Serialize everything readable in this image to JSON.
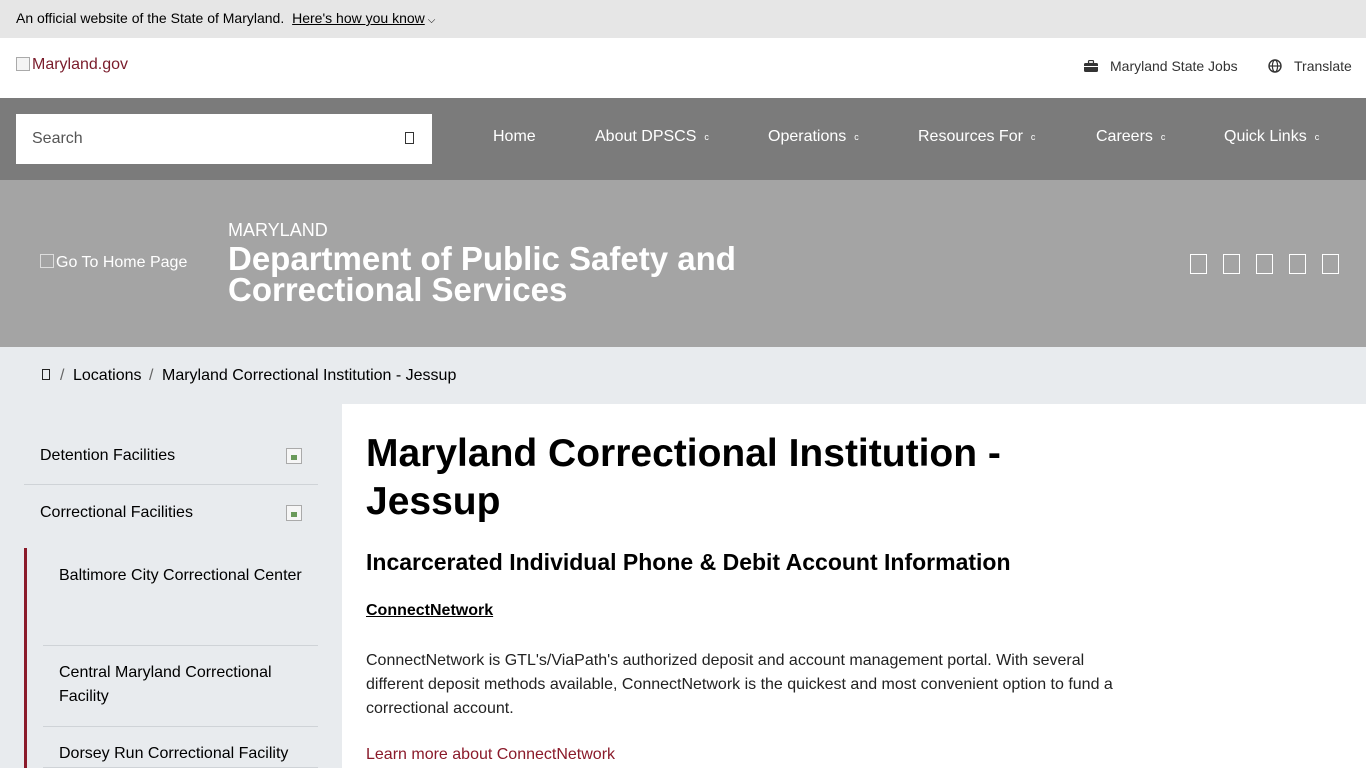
{
  "official_bar": {
    "text": "An official website of the State of Maryland.",
    "link": "Here's how you know"
  },
  "header": {
    "logo_alt": "Maryland.gov",
    "jobs_label": "Maryland State Jobs",
    "translate_label": "Translate"
  },
  "search": {
    "placeholder": "Search"
  },
  "nav": {
    "items": [
      {
        "label": "Home",
        "has_menu": false
      },
      {
        "label": "About DPSCS",
        "has_menu": true
      },
      {
        "label": "Operations",
        "has_menu": true
      },
      {
        "label": "Resources For",
        "has_menu": true
      },
      {
        "label": "Careers",
        "has_menu": true
      },
      {
        "label": "Quick Links",
        "has_menu": true
      }
    ],
    "caret": "c"
  },
  "banner": {
    "home_alt": "Go To Home Page",
    "state": "MARYLAND",
    "department": "Department of Public Safety and Correctional Services",
    "social_icons": [
      "social-icon-1",
      "social-icon-2",
      "social-icon-3",
      "social-icon-4",
      "social-icon-5"
    ]
  },
  "breadcrumb": {
    "items": [
      "Locations",
      "Maryland Correctional Institution - Jessup"
    ],
    "separator": "/"
  },
  "sidebar": {
    "items": [
      {
        "label": "Detention Facilities"
      },
      {
        "label": "Correctional Facilities"
      }
    ],
    "sub_items": [
      {
        "label": "Baltimore City Correctional Center"
      },
      {
        "label": "Central Maryland Correctional Facility"
      },
      {
        "label": "Dorsey Run Correctional Facility"
      }
    ]
  },
  "main": {
    "title": "Maryland Correctional Institution - Jessup",
    "subtitle": "Incarcerated Individual Phone & Debit Account Information",
    "link_heading": "ConnectNetwork",
    "paragraph": "ConnectNetwork is GTL's/ViaPath's authorized deposit and account management portal. With several different deposit methods available, ConnectNetwork is the quickest and most convenient option to fund a correctional account.",
    "learn_more": "Learn more about ConnectNetwork"
  },
  "colors": {
    "accent": "#8a1a2a",
    "nav_bg": "#7b7b7b",
    "banner_bg": "#a4a4a4",
    "sidebar_bg": "#e8ebee"
  }
}
